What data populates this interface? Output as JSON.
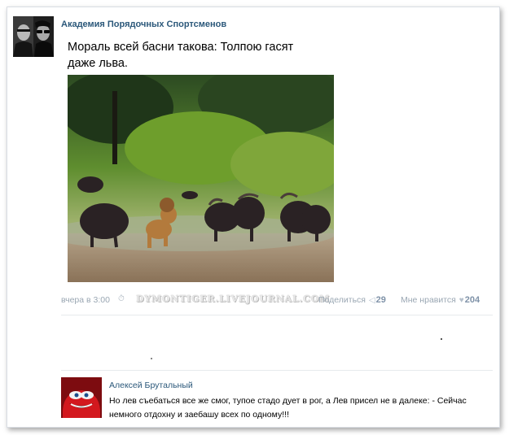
{
  "post": {
    "group_name": "Академия Порядочных Спортсменов",
    "text": "Мораль всей басни такова: Толпою гасят даже льва.",
    "date": "вчера в 3:00",
    "watermark": "DYMONTIGER.LIVEJOURNAL.COM",
    "share_label": "Поделиться",
    "share_count": "29",
    "like_label": "Мне нравится",
    "like_count": "204"
  },
  "comment": {
    "author": "Алексей Брутальный",
    "text": "Но лев съебаться все же смог, тупое стадо дует в рог, а Лев присел не в далеке: - Сейчас немного отдохну и заебашу всех по одному!!!"
  },
  "icons": {
    "clock": "clock-icon",
    "share": "megaphone-icon",
    "like": "heart-icon"
  },
  "colors": {
    "link": "#2b587a",
    "meta": "#9aa7b3",
    "counter": "#7f92a8"
  }
}
